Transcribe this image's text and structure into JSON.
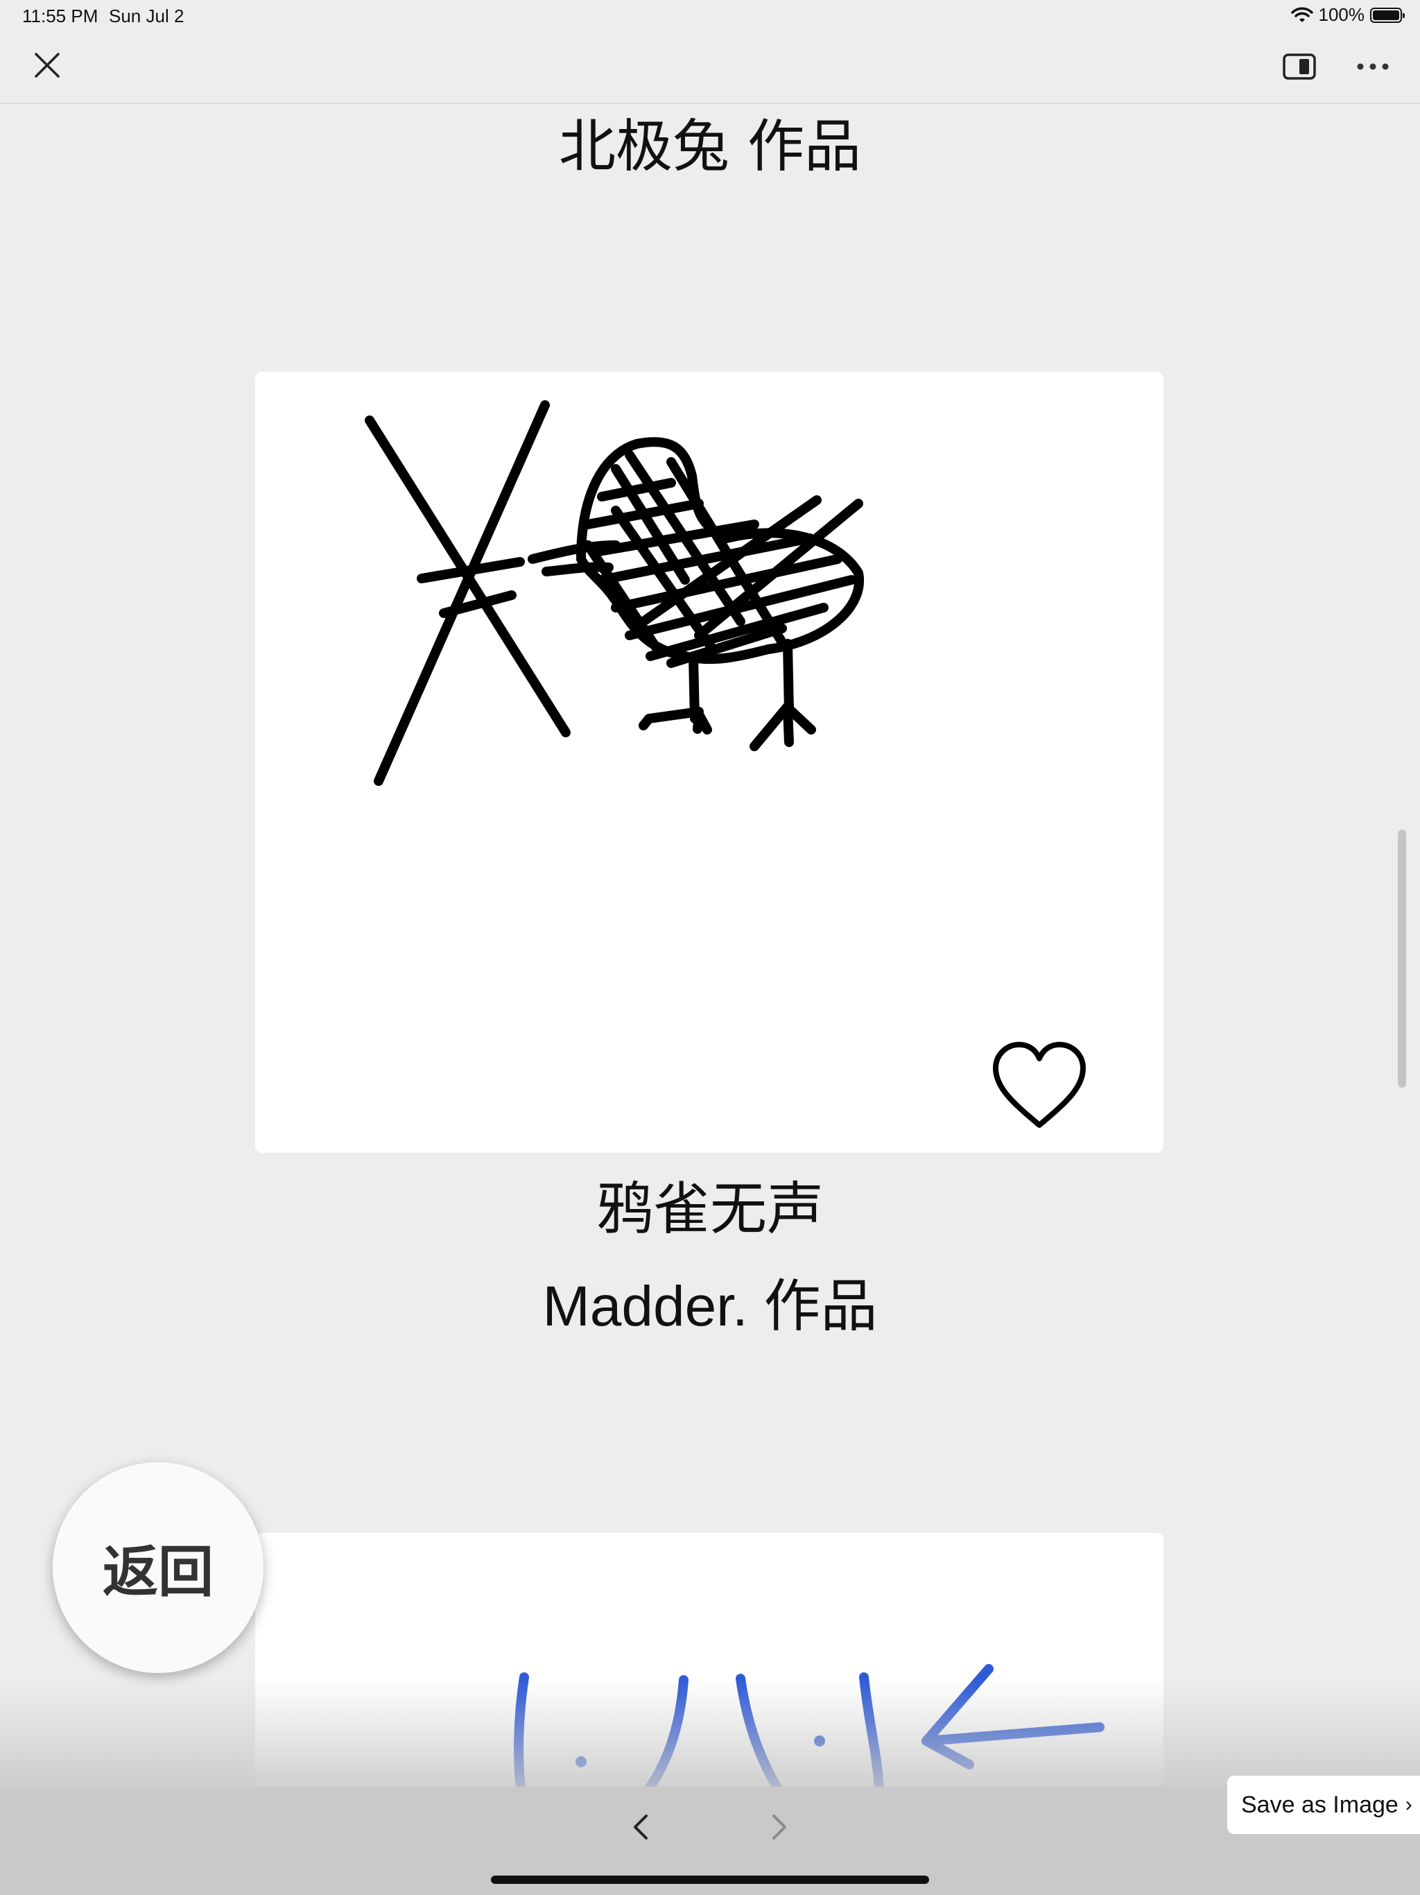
{
  "status_bar": {
    "time": "11:55 PM",
    "date": "Sun Jul 2",
    "battery": "100%"
  },
  "toolbar": {
    "close_icon": "close-icon",
    "split_icon": "split-view-icon",
    "more_icon": "more-icon"
  },
  "feed": {
    "prev_author": "北极兔 作品",
    "item": {
      "title": "鸦雀无声",
      "author": "Madder. 作品",
      "favorite_icon": "heart-outline-icon"
    }
  },
  "back_button": "返回",
  "save_as_image": "Save as Image",
  "bottom_nav": {
    "back_icon": "chevron-left-icon",
    "forward_icon": "chevron-right-icon"
  },
  "colors": {
    "background": "#ededed",
    "card": "#ffffff",
    "ink": "#000000",
    "blue_ink": "#2f5bd8",
    "bottom_bar": "#c9c9c9"
  }
}
